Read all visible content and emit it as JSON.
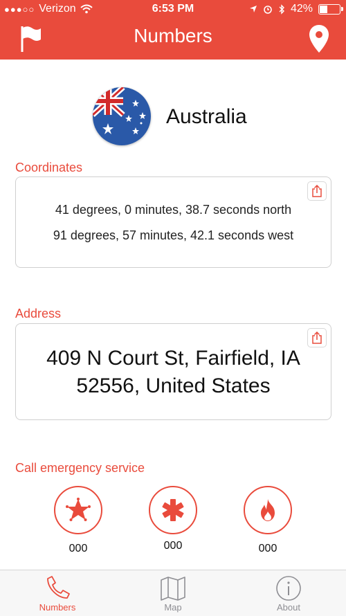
{
  "status_bar": {
    "carrier": "Verizon",
    "time": "6:53 PM",
    "battery": "42%",
    "battery_level": 0.42
  },
  "header": {
    "title": "Numbers"
  },
  "country": {
    "name": "Australia"
  },
  "coordinates": {
    "label": "Coordinates",
    "line1": "41 degrees, 0 minutes, 38.7 seconds north",
    "line2": "91 degrees, 57 minutes, 42.1 seconds west"
  },
  "address": {
    "label": "Address",
    "line1": "409 N Court St, Fairfield, IA",
    "line2": "52556, United States"
  },
  "emergency": {
    "label": "Call emergency service",
    "services": [
      {
        "icon": "police-star-icon",
        "number": "000"
      },
      {
        "icon": "medical-cross-icon",
        "number": "000"
      },
      {
        "icon": "fire-icon",
        "number": "000"
      }
    ]
  },
  "tabs": [
    {
      "label": "Numbers",
      "icon": "phone-icon",
      "active": true
    },
    {
      "label": "Map",
      "icon": "map-icon",
      "active": false
    },
    {
      "label": "About",
      "icon": "info-icon",
      "active": false
    }
  ],
  "colors": {
    "accent": "#e94b3c",
    "tab_inactive": "#8e8e93"
  }
}
